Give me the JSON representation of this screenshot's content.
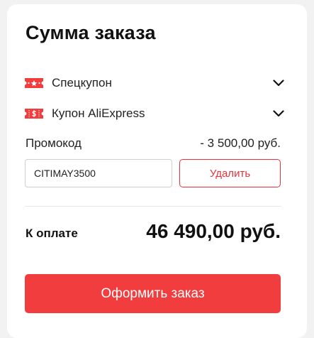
{
  "order_summary": {
    "title": "Сумма заказа",
    "coupons": [
      {
        "label": "Спецкупон",
        "icon": "special-coupon-icon"
      },
      {
        "label": "Купон AliExpress",
        "icon": "aliexpress-coupon-icon"
      }
    ],
    "promo": {
      "label": "Промокод",
      "discount": "- 3 500,00 руб.",
      "code_value": "CITIMAY3500",
      "delete_label": "Удалить"
    },
    "total": {
      "label": "К оплате",
      "amount": "46 490,00 руб."
    },
    "checkout_label": "Оформить заказ"
  },
  "colors": {
    "accent": "#f23d3f",
    "accent_outline": "#e8323a",
    "text": "#111111"
  }
}
